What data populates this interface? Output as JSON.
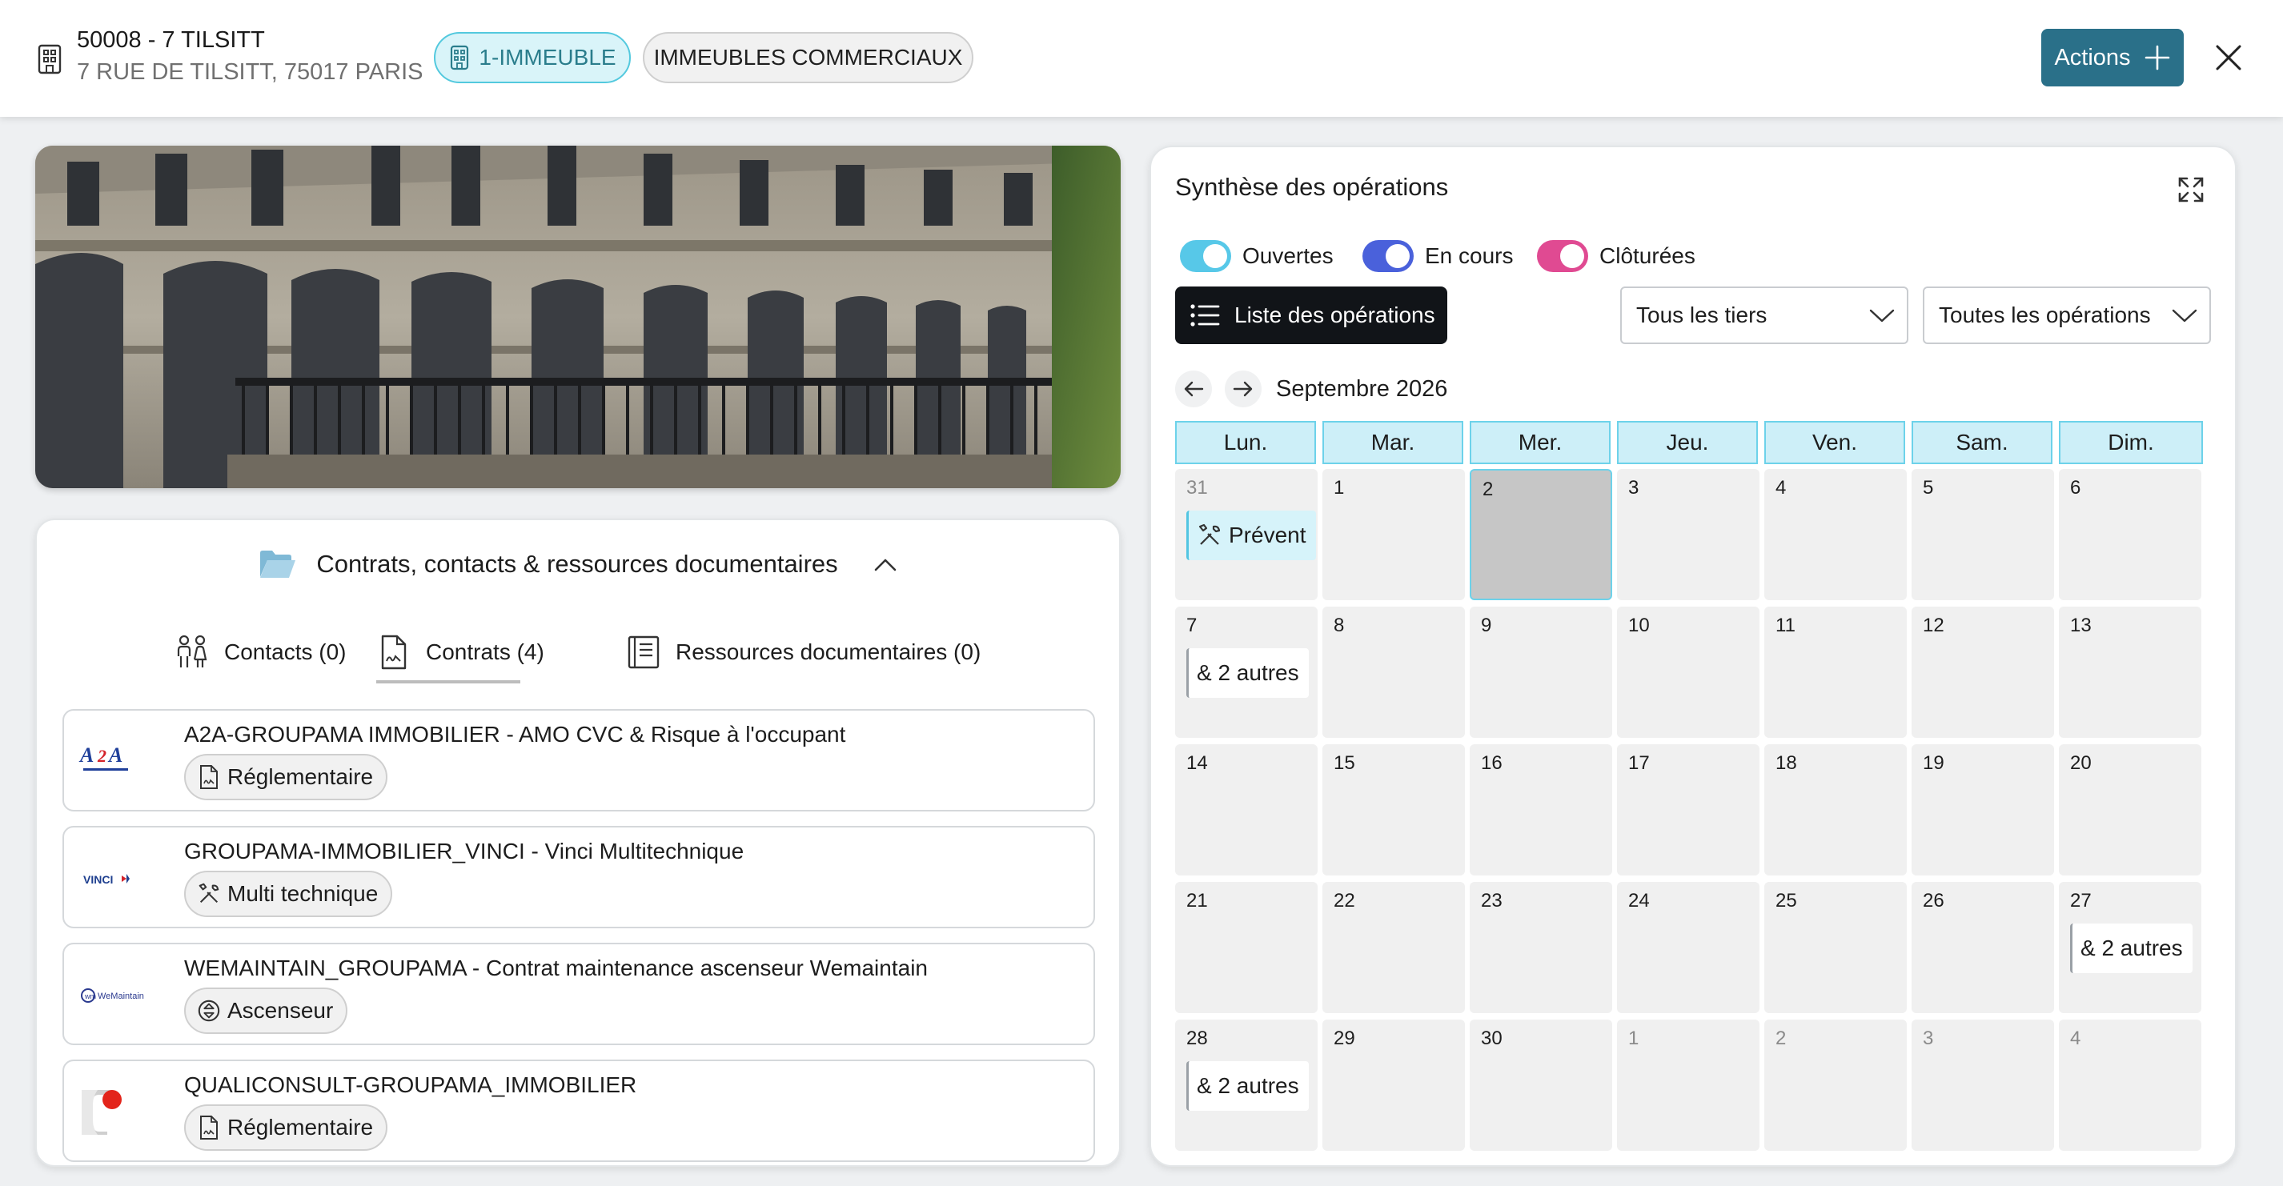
{
  "header": {
    "title": "50008 - 7 TILSITT",
    "address": "7 RUE DE TILSITT, 75017 PARIS",
    "chip_immeuble": "1-IMMEUBLE",
    "chip_commerciaux": "IMMEUBLES COMMERCIAUX",
    "actions_label": "Actions",
    "accent_color": "#2a7089"
  },
  "contracts_panel": {
    "title": "Contrats, contacts & ressources documentaires",
    "tabs": [
      {
        "label": "Contacts (0)",
        "icon": "people-icon"
      },
      {
        "label": "Contrats (4)",
        "icon": "contract-document-icon",
        "active": true
      },
      {
        "label": "Ressources documentaires (0)",
        "icon": "book-icon"
      }
    ],
    "contracts": [
      {
        "name": "A2A-GROUPAMA IMMOBILIER - AMO CVC & Risque à l'occupant",
        "tag": "Réglementaire",
        "tag_icon": "regulation-document-icon",
        "logo": "a2a-logo"
      },
      {
        "name": "GROUPAMA-IMMOBILIER_VINCI - Vinci Multitechnique",
        "tag": "Multi technique",
        "tag_icon": "tools-icon",
        "logo": "vinci-logo"
      },
      {
        "name": "WEMAINTAIN_GROUPAMA - Contrat maintenance ascenseur Wemaintain",
        "tag": "Ascenseur",
        "tag_icon": "elevator-icon",
        "logo": "wemaintain-logo"
      },
      {
        "name": "QUALICONSULT-GROUPAMA_IMMOBILIER",
        "tag": "Réglementaire",
        "tag_icon": "regulation-document-icon",
        "logo": "qualiconsult-logo"
      }
    ]
  },
  "operations": {
    "title": "Synthèse des opérations",
    "toggles": [
      {
        "label": "Ouvertes",
        "on": true,
        "color": "#57c8e8"
      },
      {
        "label": "En cours",
        "on": true,
        "color": "#4a61db"
      },
      {
        "label": "Clôturées",
        "on": true,
        "color": "#e04a92"
      }
    ],
    "list_button": "Liste des opérations",
    "filter_tiers": "Tous les tiers",
    "filter_operations": "Toutes les opérations",
    "month": "Septembre 2026",
    "weekdays": [
      "Lun.",
      "Mar.",
      "Mer.",
      "Jeu.",
      "Ven.",
      "Sam.",
      "Dim."
    ],
    "weeks": [
      [
        {
          "d": "31",
          "m": true
        },
        {
          "d": "1"
        },
        {
          "d": "2",
          "sel": true
        },
        {
          "d": "3"
        },
        {
          "d": "4"
        },
        {
          "d": "5"
        },
        {
          "d": "6"
        }
      ],
      [
        {
          "d": "7"
        },
        {
          "d": "8"
        },
        {
          "d": "9"
        },
        {
          "d": "10"
        },
        {
          "d": "11"
        },
        {
          "d": "12"
        },
        {
          "d": "13"
        }
      ],
      [
        {
          "d": "14"
        },
        {
          "d": "15"
        },
        {
          "d": "16"
        },
        {
          "d": "17"
        },
        {
          "d": "18"
        },
        {
          "d": "19"
        },
        {
          "d": "20"
        }
      ],
      [
        {
          "d": "21"
        },
        {
          "d": "22"
        },
        {
          "d": "23"
        },
        {
          "d": "24"
        },
        {
          "d": "25"
        },
        {
          "d": "26"
        },
        {
          "d": "27"
        }
      ],
      [
        {
          "d": "28"
        },
        {
          "d": "29"
        },
        {
          "d": "30"
        },
        {
          "d": "1",
          "m": true
        },
        {
          "d": "2",
          "m": true
        },
        {
          "d": "3",
          "m": true
        },
        {
          "d": "4",
          "m": true
        }
      ]
    ],
    "events": {
      "w0d0": {
        "label": "Prévent",
        "type": "prevent",
        "icon": "tools-icon"
      },
      "w1d0": {
        "label": "& 2 autres"
      },
      "w3d6": {
        "label": "& 2 autres"
      },
      "w4d0": {
        "label": "& 2 autres"
      }
    }
  }
}
